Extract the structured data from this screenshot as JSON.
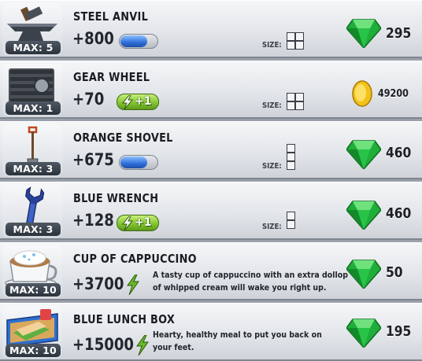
{
  "items": [
    {
      "name": "STEEL ANVIL",
      "value": "+800",
      "max": "MAX: 5",
      "size_label": "SIZE:",
      "currency": "gem-icon",
      "price": "295",
      "bonus": "",
      "description": ""
    },
    {
      "name": "GEAR WHEEL",
      "value": "+70",
      "max": "MAX: 1",
      "size_label": "SIZE:",
      "currency": "coin-icon",
      "price": "49200",
      "bonus": "+1",
      "description": ""
    },
    {
      "name": "ORANGE SHOVEL",
      "value": "+675",
      "max": "MAX: 3",
      "size_label": "SIZE:",
      "currency": "gem-icon",
      "price": "460",
      "bonus": "",
      "description": ""
    },
    {
      "name": "BLUE WRENCH",
      "value": "+128",
      "max": "MAX: 3",
      "size_label": "SIZE:",
      "currency": "gem-icon",
      "price": "460",
      "bonus": "+1",
      "description": ""
    },
    {
      "name": "CUP OF CAPPUCCINO",
      "value": "+3700",
      "max": "MAX: 10",
      "size_label": "",
      "currency": "gem-icon",
      "price": "50",
      "bonus": "",
      "description": "A tasty cup of cappuccino with an extra dollop of whipped cream will wake you right up."
    },
    {
      "name": "BLUE LUNCH BOX",
      "value": "+15000",
      "max": "MAX: 10",
      "size_label": "",
      "currency": "gem-icon",
      "price": "195",
      "bonus": "",
      "description": "Hearty, healthy meal to put you back on your feet."
    }
  ],
  "colors": {
    "gem": "#1fae3a",
    "coin": "#f2c21a",
    "energy": "#66b82a",
    "bar": "#2f6fd8"
  }
}
